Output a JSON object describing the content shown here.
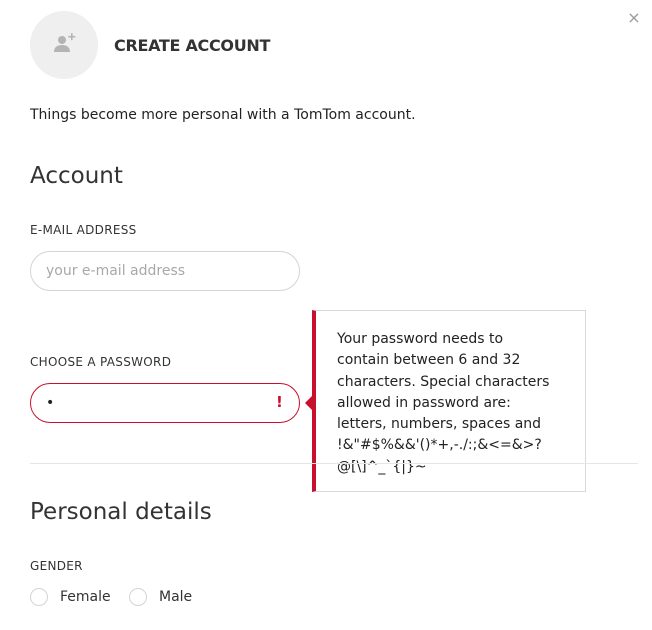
{
  "dialog": {
    "title": "CREATE ACCOUNT",
    "close_glyph": "×",
    "avatar_icon": "add-user-icon",
    "intro": "Things become more personal with a TomTom account."
  },
  "account": {
    "heading": "Account",
    "email": {
      "label": "E-MAIL ADDRESS",
      "placeholder": "your e-mail address",
      "value": ""
    },
    "password": {
      "label": "CHOOSE A PASSWORD",
      "value": "•",
      "error_glyph": "!"
    }
  },
  "tooltip": {
    "lines": [
      "Your password needs to",
      "contain between 6 and 32",
      "characters. Special characters",
      "allowed in password are:",
      "letters, numbers, spaces and",
      "!&\"#$%&&'()*+,-./:;&<=&>?",
      "@[\\]^_`{|}~"
    ]
  },
  "personal": {
    "heading": "Personal details",
    "gender": {
      "label": "GENDER",
      "options": [
        "Female",
        "Male"
      ]
    }
  },
  "colors": {
    "error": "#c8102e",
    "border": "#d4d4d4",
    "avatar_bg": "#efefef"
  }
}
